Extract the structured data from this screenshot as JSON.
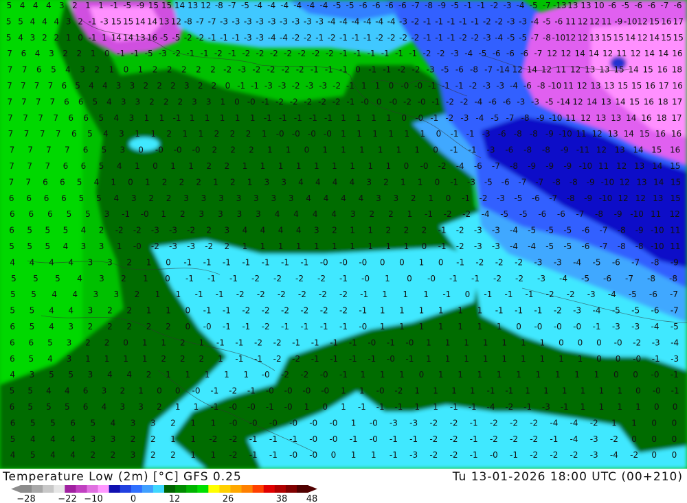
{
  "title": {
    "left": "Temperature Low (2m) [°C] GFS 0.25",
    "right": "Tu 13-01-2026 18:00 UTC (00+210)"
  },
  "color_scale": {
    "tick_labels": [
      "−28",
      "−22",
      "−10",
      "0",
      "12",
      "26",
      "38",
      "48"
    ],
    "colors": [
      "#8c8c8c",
      "#a8a8a8",
      "#c8c8c8",
      "#e6e6e6",
      "#a020a0",
      "#c040c0",
      "#e070e0",
      "#ff99ff",
      "#1010b0",
      "#2040e0",
      "#3070ff",
      "#40a0ff",
      "#40d8ff",
      "#006400",
      "#008c00",
      "#00b400",
      "#00e000",
      "#ffff00",
      "#ffd000",
      "#ffa800",
      "#ff8000",
      "#ff4000",
      "#e00000",
      "#b00000",
      "#800000",
      "#500000"
    ]
  },
  "map": {
    "palette": {
      "ocean_green": "#00c000",
      "land_green": "#007000",
      "cyan": "#40e8ff",
      "light_blue": "#40a8ff",
      "blue": "#3060ff",
      "dark_blue": "#1010c8",
      "magenta": "#e060f0",
      "pink": "#ff90ff"
    },
    "rows": [
      "5 4 4 4 3 2 1 1 -1 -5 -9 15 15 14 13 12 -8 -7 -5 -4 -4 -4 -4 -4 -4 -5 -5 -6 -6 -6 -6 -7 -8 -9 -5 -1 -1 -2 -3 -4 -5 -7 -13 13 13 10 -6 -5 -6 -6 -7 -6",
      "5 5 4 4 4 3 2 -1 -3 15 15 14 14 13 12 -8 -7 -7 -3 -3 -3 -3 -3 -3 -3 -3 -3 -4 -4 -4 -4 -4 -4 -3 -2 -1 -1 -1 -1 -1 -2 -2 -3 -3 -4 -5 -6 11 12 12 11 -9 -10 12 15 16 17",
      "5 4 3 2 2 1 0 -1 1 14 14 13 16 -5 -5 -2 -2 -1 -1 -1 -3 -3 -4 -4 -2 -2 -1 -2 -1 -1 -1 -2 -2 -2 -2 -1 -1 -1 -2 -2 -3 -4 -5 -5 -7 -8 -10 12 12 13 15 15 14 12 14 15 15",
      "7 6 4 3 2 2 1 0 -1 -1 -5 -3 -2 -1 -1 -2 -1 -2 -2 -2 -2 -2 -2 -2 -1 -1 -1 -1 -1 -1 -2 -2 -3 -4 -5 -6 -6 -6 -7 12 12 14 14 12 11 12 14 14 16",
      "7 7 6 5 4 3 2 1 0 1 2 2 2 2 2 -2 -3 -2 -2 -2 -2 -1 -1 -1 0 -1 -1 -2 -2 -3 -5 -6 -8 -7 -14 12 14 12 11 12 13 13 15 14 15 16 18",
      "7 7 7 7 6 5 4 4 3 3 2 2 2 3 2 2 0 -1 -1 -3 -3 -2 -3 -3 -2 -1 1 1 0 -0 -0 -1 -1 -1 -2 -3 -3 -4 -6 -8 -10 11 12 13 13 15 15 16 17 16",
      "7 7 7 7 6 6 5 4 3 3 2 2 2 3 3 1 0 -0 -1 -2 -2 -2 -2 -2 -1 -0 0 -0 -2 -0 -1 -2 -2 -4 -6 -6 -3 -3 -5 -14 12 14 13 14 15 16 18 17",
      "7 7 7 7 6 6 5 4 3 1 1 -1 1 1 1 1 1 -1 -1 -1 -1 -1 1 1 1 1 0 -0 -1 -2 -3 -4 -5 -7 -8 -9 -10 11 12 13 13 14 16 18 17",
      "7 7 7 7 6 5 4 3 1 1 2 1 1 2 2 2 1 -0 -0 -0 -0 1 1 1 1 1 1 0 -1 -1 -3 -6 -8 -8 -9 -10 11 12 13 14 15 16 16",
      "7 7 7 7 6 5 3 0 -0 -0 -0 2 2 2 1 1 0 1 1 1 1 1 1 0 -1 -1 -3 -6 -8 -8 -9 -11 12 13 14 15 16",
      "7 7 7 6 6 5 4 1 0 1 1 2 2 1 1 1 1 1 1 1 1 1 0 -0 -2 -4 -6 -7 -8 -9 -9 -9 -10 11 12 13 14 15",
      "7 7 6 6 5 4 1 0 1 2 2 2 1 2 1 3 3 4 4 4 4 3 2 1 1 0 -1 -3 -5 -6 -7 -7 -8 -8 -9 -10 12 13 14 15",
      "6 6 6 6 5 5 4 3 2 2 3 3 3 3 3 3 3 4 4 4 4 3 3 2 1 0 -1 -2 -3 -5 -6 -7 -8 -9 -10 12 12 13 15",
      "6 6 6 5 5 3 -1 -0 1 2 3 3 3 3 4 4 4 4 3 2 2 1 -1 -2 -2 -4 -5 -5 -6 -6 -7 -8 -9 -10 11 12",
      "6 5 5 5 4 2 -2 -2 -3 -3 -2 2 3 4 4 4 4 3 2 1 1 2 2 2 -1 -2 -3 -3 -4 -5 -5 -5 -6 -7 -8 -9 -10 11",
      "5 5 5 4 3 3 1 -0 -2 -3 -3 -2 2 1 1 1 1 1 1 1 1 1 1 0 -1 -2 -3 -3 -4 -4 -5 -5 -6 -7 -8 -8 -10 11",
      "4 4 4 4 3 3 2 1 0 -1 -1 -1 -1 -1 -1 -1 -0 -0 -0 0 0 1 0 -1 -2 -2 -2 -3 -3 -4 -5 -6 -7 -8 -9",
      "5 5 5 4 3 2 1 0 -1 -1 -1 -2 -2 -2 -2 -1 -0 1 0 -0 -1 -1 -2 -2 -3 -4 -5 -6 -7 -8 -8",
      "5 5 4 4 3 3 2 1 1 -1 -1 -2 -2 -2 -2 -2 -2 -1 1 1 1 -1 0 -1 -1 -1 -2 -2 -3 -4 -5 -6 -7",
      "5 5 4 4 3 2 2 1 1 0 -1 -1 -2 -2 -2 -2 -2 -2 -1 1 1 1 1 1 1 -1 -1 -1 -2 -3 -4 -5 -5 -6 -7",
      "6 5 4 3 2 2 2 2 2 0 -0 -1 -1 -2 -1 -1 -1 -1 -0 1 1 1 1 1 1 1 0 -0 -0 -0 -1 -3 -3 -4 -5",
      "6 6 5 3 2 2 0 1 1 2 1 -1 -1 -2 -2 -1 -1 -1 -1 -0 -1 -0 1 1 1 1 1 1 1 0 0 0 -0 -2 -3 -4",
      "6 5 4 3 1 1 1 1 2 2 2 1 -1 -1 -2 -2 -1 -1 -1 -1 -0 -1 1 1 1 1 1 1 1 1 1 0 0 -0 -1 -3",
      "4 3 5 5 3 4 4 2 1 1 1 1 1 -0 -2 -2 -0 -1 1 1 1 0 1 1 1 1 1 1 1 1 1 0 0 -0 -1",
      "5 5 4 4 6 3 2 1 0 0 -0 -1 -2 -1 -0 -0 -0 -0 1 1 -0 -2 1 1 1 1 -1 -1 1 1 1 1 1 1 0 -0 -1",
      "6 5 5 5 6 4 3 3 2 1 1 -1 -0 -0 -1 -0 1 0 1 -1 -1 -1 1 1 -1 -1 -4 -2 -1 -3 -1 1 1 1 1 0 0",
      "6 5 5 6 5 4 3 3 2 1 1 -0 -0 -0 -0 -0 -0 1 -0 -3 -3 -2 -2 -1 -2 -2 -2 -4 -4 -2 1 1 0 0",
      "5 4 4 4 3 3 2 2 1 1 -2 -2 -1 -1 -1 -0 -0 -1 -0 -1 -1 -2 -2 -1 -2 -2 -2 -1 -4 -3 -2 0 0 0",
      "4 5 4 4 2 2 3 2 2 1 1 -2 -1 -1 -0 -0 0 1 1 -1 -3 -2 -2 -1 -0 -1 -2 -2 -2 -3 -4 -2 0 0"
    ]
  }
}
